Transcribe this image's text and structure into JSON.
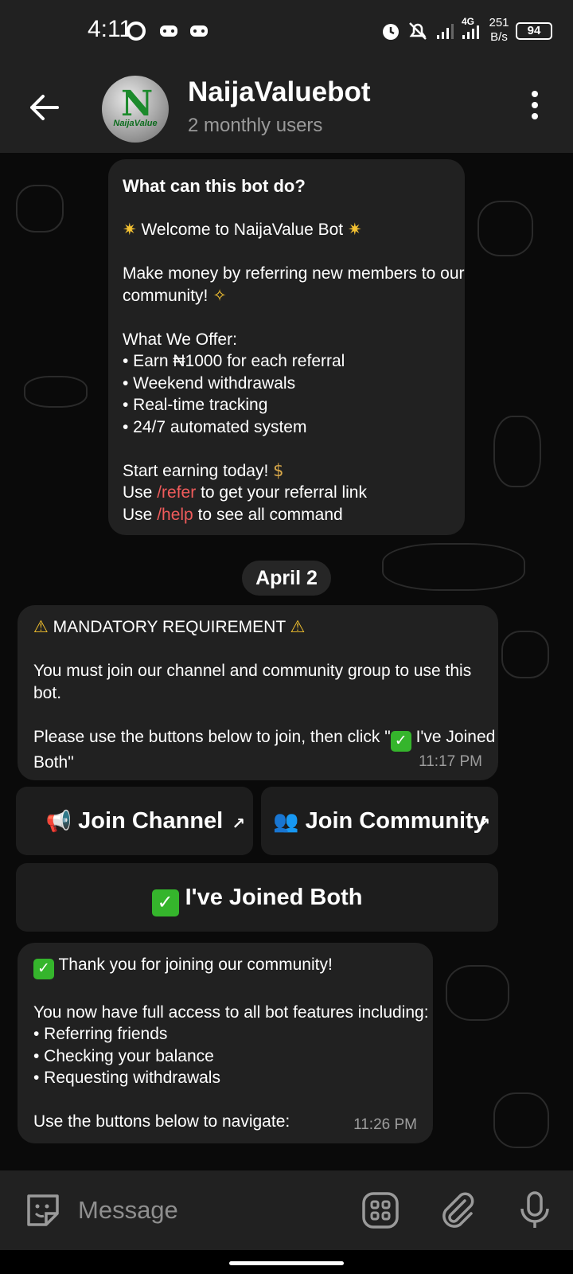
{
  "status_bar": {
    "time": "4:11",
    "network_label": "4G",
    "speed_value": "251",
    "speed_unit": "B/s",
    "battery": "94",
    "icons": [
      "circle-icon",
      "gamepad-icon",
      "gamepad-icon",
      "alarm-icon",
      "mute-icon",
      "signal-icon",
      "signal-icon",
      "battery-icon"
    ]
  },
  "header": {
    "title": "NaijaValuebot",
    "subtitle": "2 monthly users",
    "avatar_logo_letter": "N",
    "avatar_logo_text": "NaijaValue"
  },
  "intro_bubble": {
    "title": "What can this bot do?",
    "welcome": "Welcome to NaijaValue Bot",
    "pitch_line1": "Make money by referring new members to our",
    "pitch_line2": "community!",
    "offer_heading": "What We Offer:",
    "offers": [
      "• Earn ₦1000 for each referral",
      "• Weekend withdrawals",
      "• Real-time tracking",
      "• 24/7 automated system"
    ],
    "cta": "Start earning today!",
    "use_word": "Use",
    "refer_cmd": "/refer",
    "refer_rest": "to get your referral link",
    "help_cmd": "/help",
    "help_rest": "to see all command"
  },
  "date_separator": "April 2",
  "requirement_bubble": {
    "heading": "MANDATORY REQUIREMENT",
    "line1": "You must join our channel and community group to use this",
    "line2": "bot.",
    "line3_a": "Please use the buttons below to join, then click \"",
    "line3_b": "I've Joined",
    "line4": "Both\"",
    "time": "11:17 PM"
  },
  "buttons": {
    "join_channel": "Join Channel",
    "join_community": "Join Community",
    "joined_both": "I've Joined Both"
  },
  "thanks_bubble": {
    "line1": "Thank you for joining our community!",
    "line2": "You now have full access to all bot features including:",
    "features": [
      "• Referring friends",
      "• Checking your balance",
      "• Requesting withdrawals"
    ],
    "line_nav": "Use the buttons below to navigate:",
    "time": "11:26 PM"
  },
  "input": {
    "placeholder": "Message"
  }
}
